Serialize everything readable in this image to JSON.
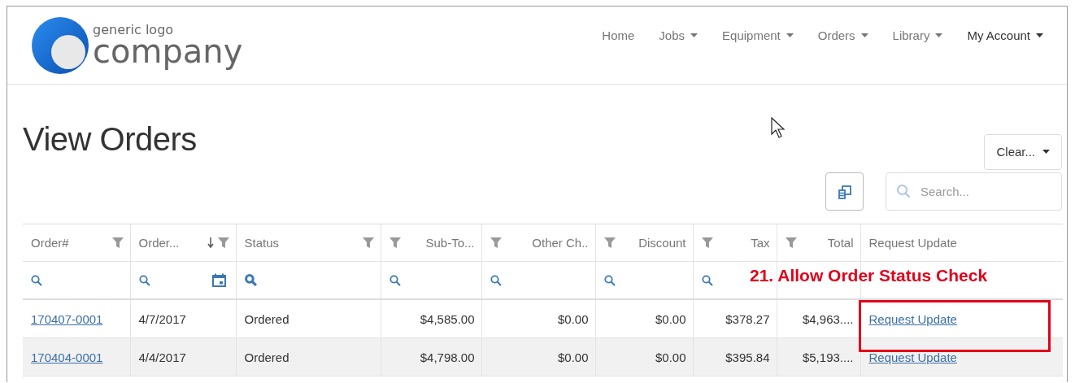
{
  "logo": {
    "tagline": "generic logo",
    "name": "company"
  },
  "nav": [
    {
      "label": "Home",
      "dropdown": false
    },
    {
      "label": "Jobs",
      "dropdown": true
    },
    {
      "label": "Equipment",
      "dropdown": true
    },
    {
      "label": "Orders",
      "dropdown": true
    },
    {
      "label": "Library",
      "dropdown": true
    },
    {
      "label": "My Account",
      "dropdown": true
    }
  ],
  "page_title": "View Orders",
  "clear_button": {
    "label": "Clear..."
  },
  "search": {
    "placeholder": "Search..."
  },
  "table": {
    "columns": [
      {
        "label": "Order#",
        "filter_icon": true,
        "icon_first": false,
        "sorted_descending": false,
        "numeric": false
      },
      {
        "label": "Order...",
        "filter_icon": true,
        "icon_first": false,
        "sorted_descending": true,
        "numeric": false
      },
      {
        "label": "Status",
        "filter_icon": true,
        "icon_first": false,
        "sorted_descending": false,
        "numeric": false
      },
      {
        "label": "Sub-To...",
        "filter_icon": true,
        "icon_first": true,
        "sorted_descending": false,
        "numeric": true
      },
      {
        "label": "Other Ch..",
        "filter_icon": true,
        "icon_first": true,
        "sorted_descending": false,
        "numeric": true
      },
      {
        "label": "Discount",
        "filter_icon": true,
        "icon_first": true,
        "sorted_descending": false,
        "numeric": true
      },
      {
        "label": "Tax",
        "filter_icon": true,
        "icon_first": true,
        "sorted_descending": false,
        "numeric": true
      },
      {
        "label": "Total",
        "filter_icon": true,
        "icon_first": true,
        "sorted_descending": false,
        "numeric": true
      },
      {
        "label": "Request Update",
        "filter_icon": false,
        "sorted_descending": false,
        "numeric": false
      }
    ],
    "filter_row": [
      {
        "kind": "search"
      },
      {
        "kind": "date"
      },
      {
        "kind": "active"
      },
      {
        "kind": "search"
      },
      {
        "kind": "search"
      },
      {
        "kind": "search"
      },
      {
        "kind": "search"
      },
      {
        "kind": "blank"
      },
      {
        "kind": "blank"
      }
    ],
    "rows": [
      {
        "cells": [
          "170407-0001",
          "4/7/2017",
          "Ordered",
          "$4,585.00",
          "$0.00",
          "$0.00",
          "$378.27",
          "$4,963....",
          "Request Update"
        ],
        "striped": false
      },
      {
        "cells": [
          "170404-0001",
          "4/4/2017",
          "Ordered",
          "$4,798.00",
          "$0.00",
          "$0.00",
          "$395.84",
          "$5,193....",
          "Request Update"
        ],
        "striped": true
      }
    ]
  },
  "annotation": {
    "text": "21. Allow Order Status Check"
  }
}
